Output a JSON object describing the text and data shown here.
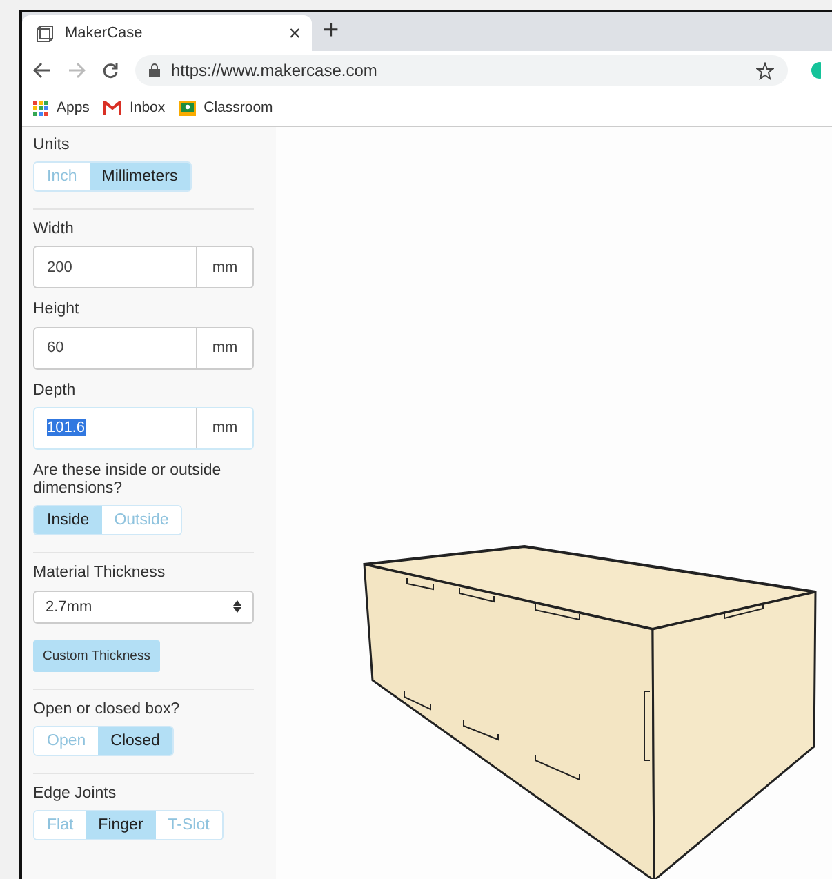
{
  "browser": {
    "tab": {
      "title": "MakerCase",
      "close": "×"
    },
    "new_tab": "+",
    "url": "https://www.makercase.com",
    "bookmarks": [
      {
        "kind": "apps",
        "label": "Apps"
      },
      {
        "kind": "mail",
        "label": "Inbox"
      },
      {
        "kind": "classroom",
        "label": "Classroom"
      }
    ]
  },
  "sidebar": [
    {
      "kind": "segmented",
      "label": "Units",
      "options": [
        {
          "label": "Inch",
          "selected": false
        },
        {
          "label": "Millimeters",
          "selected": true
        }
      ]
    },
    {
      "kind": "fields",
      "fields": [
        {
          "label": "Width",
          "value": "200",
          "unit": "mm",
          "highlighted": false
        },
        {
          "label": "Height",
          "value": "60",
          "unit": "mm",
          "highlighted": false
        },
        {
          "label": "Depth",
          "value": "101.6",
          "unit": "mm",
          "highlighted": true
        }
      ],
      "question": "Are these inside or outside dimensions?",
      "options": [
        {
          "label": "Inside",
          "selected": true
        },
        {
          "label": "Outside",
          "selected": false
        }
      ]
    },
    {
      "kind": "select",
      "label": "Material Thickness",
      "value": "2.7mm",
      "button": "Custom Thickness"
    },
    {
      "kind": "segmented",
      "label": "Open or closed box?",
      "options": [
        {
          "label": "Open",
          "selected": false
        },
        {
          "label": "Closed",
          "selected": true
        }
      ]
    },
    {
      "kind": "segmented",
      "label": "Edge Joints",
      "options": [
        {
          "label": "Flat",
          "selected": false
        },
        {
          "label": "Finger",
          "selected": true
        },
        {
          "label": "T-Slot",
          "selected": false
        }
      ]
    }
  ]
}
